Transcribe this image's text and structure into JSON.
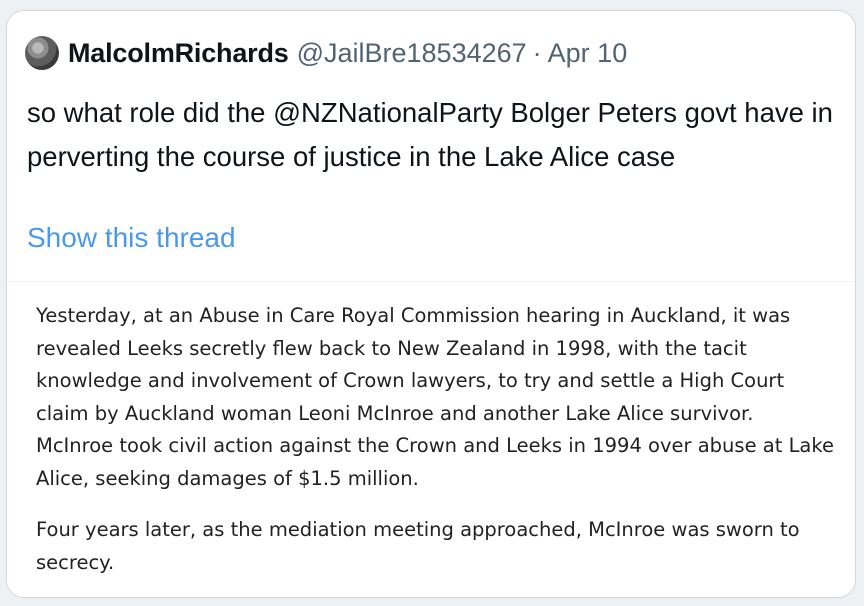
{
  "tweet": {
    "display_name": "MalcolmRichards",
    "handle": "@JailBre18534267",
    "separator": "·",
    "date": "Apr 10",
    "text": "so what role did the @NZNationalParty Bolger Peters govt have in perverting the course of justice in the Lake Alice case",
    "show_thread_label": "Show this thread"
  },
  "attached_image": {
    "paragraphs": [
      "Yesterday, at an Abuse in Care Royal Commission hearing in Auckland, it was revealed Leeks secretly flew back to New Zealand in 1998, with the tacit knowledge and involvement of Crown lawyers, to try and settle a High Court claim by Auckland woman Leoni McInroe and another Lake Alice survivor. McInroe took civil action against the Crown and Leeks in 1994 over abuse at Lake Alice, seeking damages of $1.5 million.",
      "Four years later, as the mediation meeting approached, McInroe was sworn to secrecy."
    ]
  },
  "colors": {
    "link": "#4a99e9",
    "text": "#0f1419",
    "muted": "#536471",
    "border": "#cfd9de"
  },
  "icons": {
    "avatar": "user-avatar"
  }
}
